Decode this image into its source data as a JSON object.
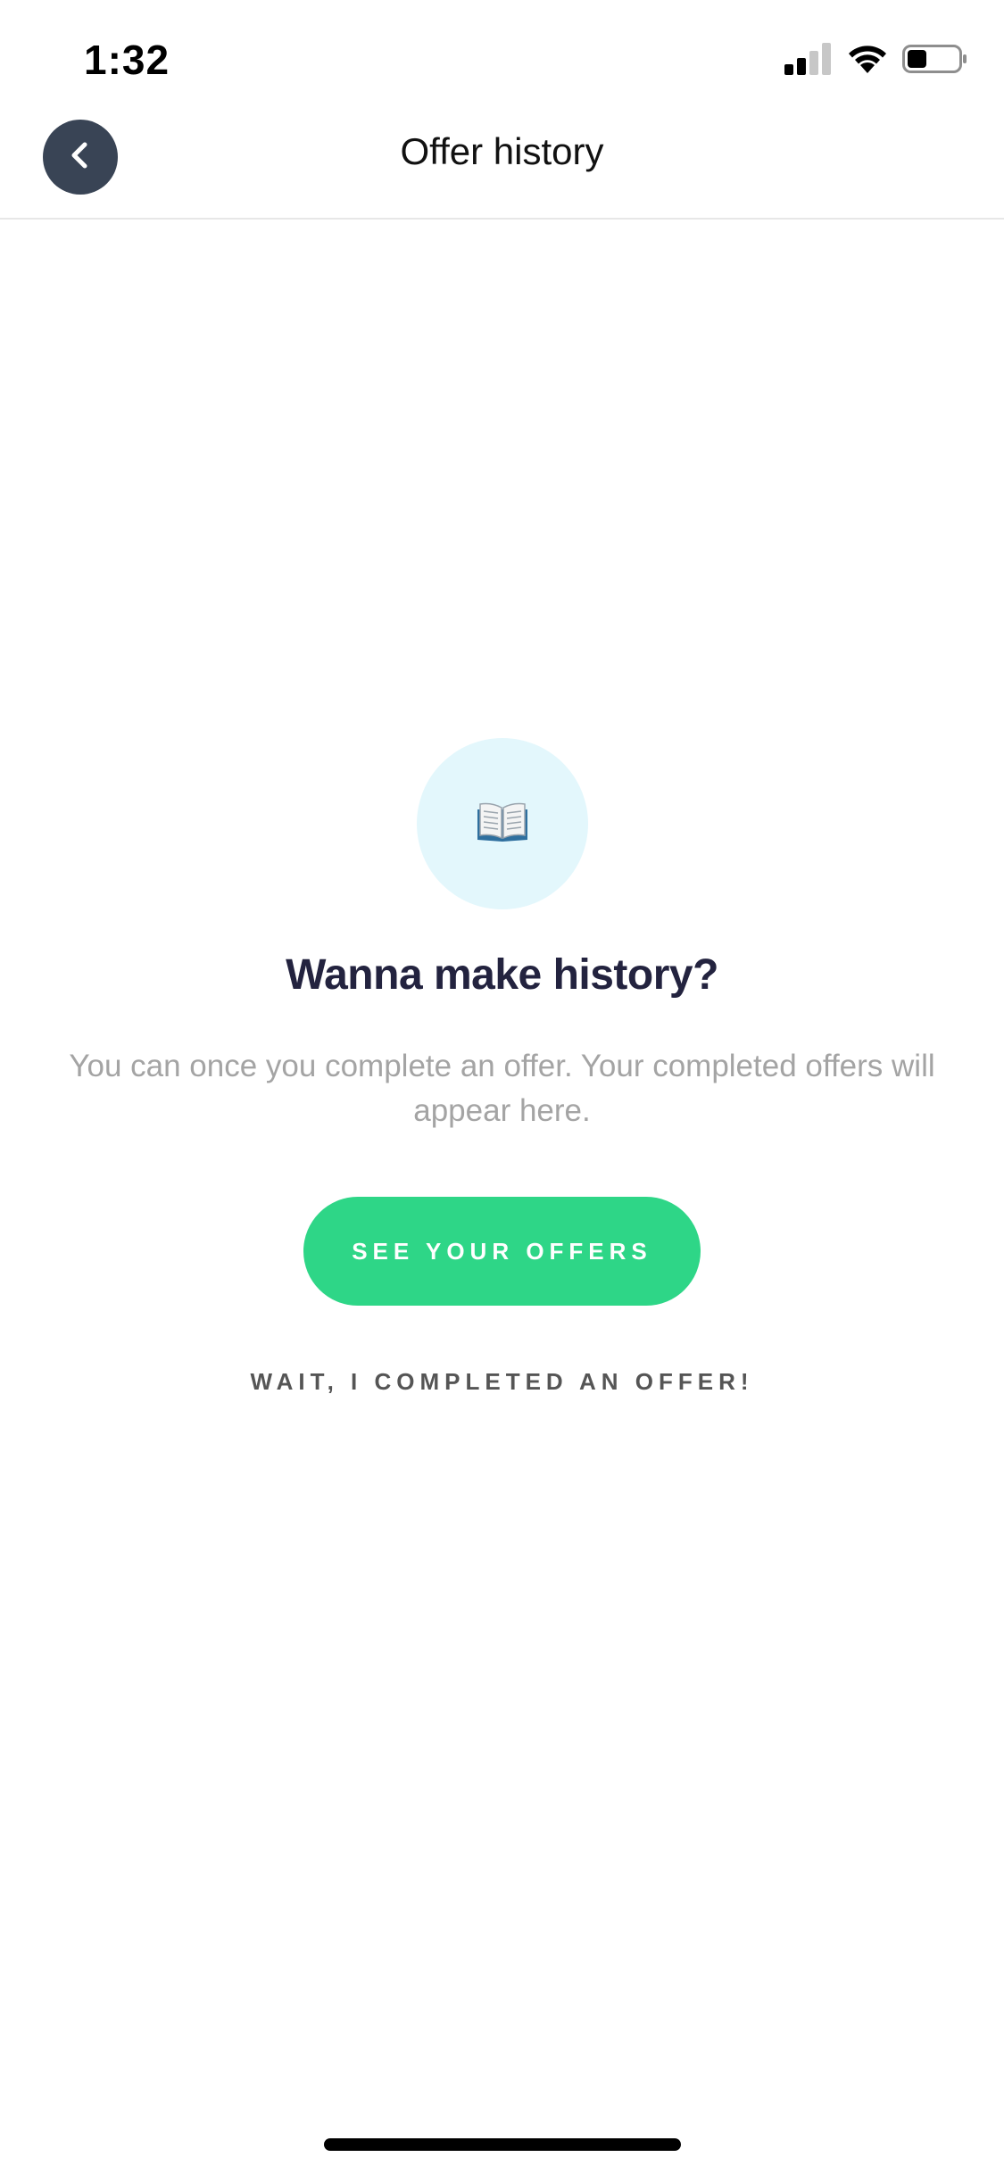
{
  "status_bar": {
    "time": "1:32",
    "icons": [
      "signal-icon",
      "wifi-icon",
      "battery-icon"
    ]
  },
  "nav": {
    "title": "Offer history",
    "back_icon": "chevron-left-icon"
  },
  "empty_state": {
    "icon": "open-book-icon",
    "title": "Wanna make history?",
    "description": "You can once you complete an offer. Your completed offers will appear here.",
    "primary_button": "SEE YOUR OFFERS",
    "secondary_link": "WAIT, I COMPLETED AN OFFER!"
  },
  "colors": {
    "accent_green": "#2ed687",
    "back_button_bg": "#394455",
    "icon_circle_bg": "#e3f7fc",
    "title_text": "#23233f",
    "muted_text": "#a4a4a4"
  }
}
